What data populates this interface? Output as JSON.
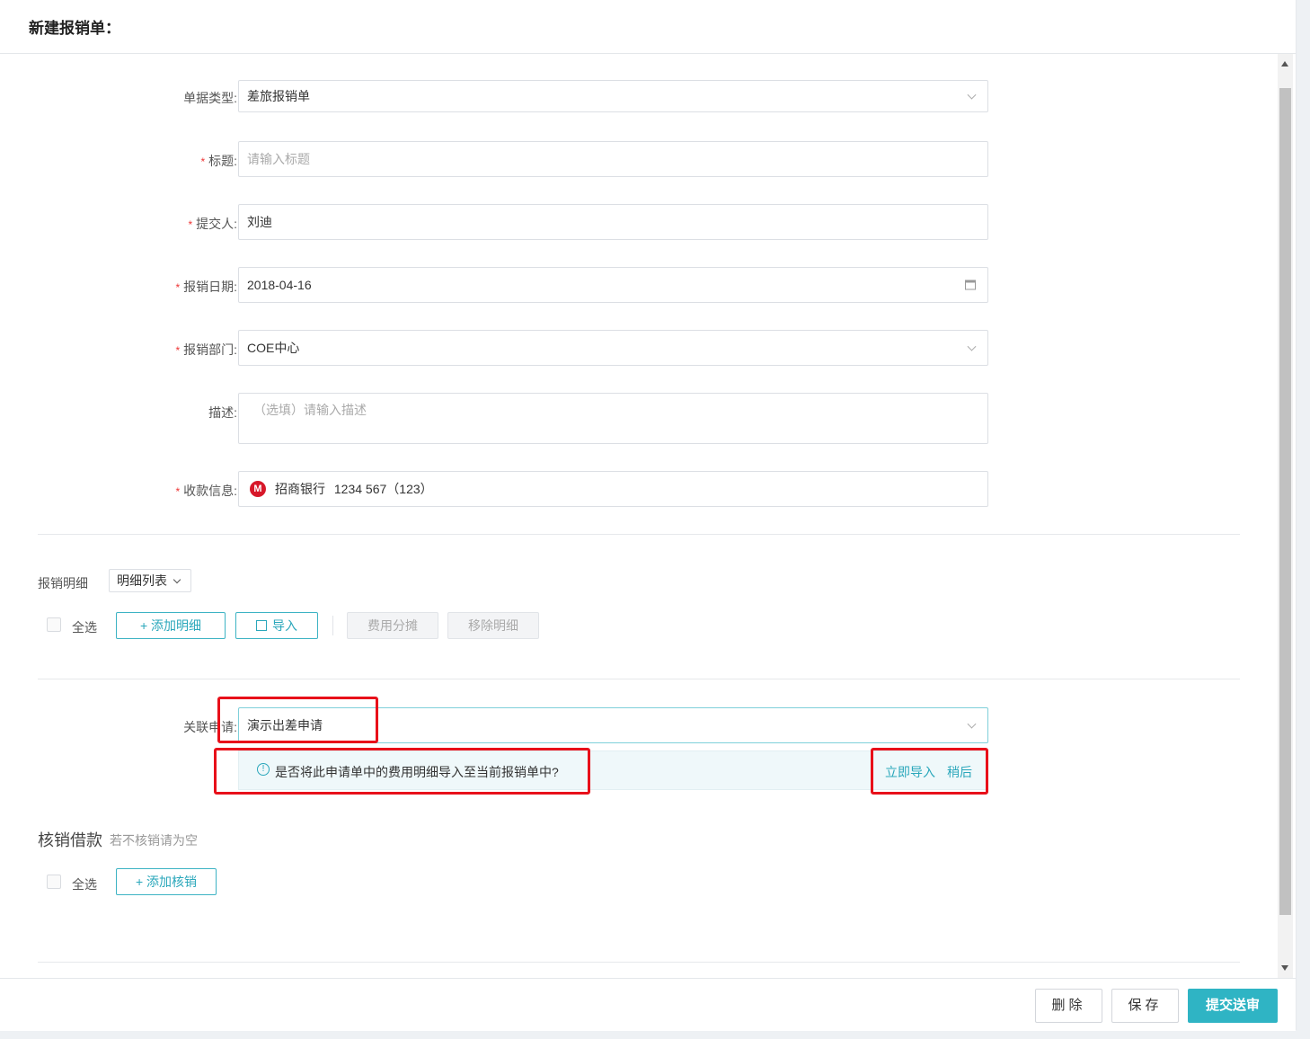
{
  "header": {
    "title": "新建报销单："
  },
  "form": {
    "doc_type": {
      "label": "单据类型:",
      "value": "差旅报销单"
    },
    "title": {
      "label": "标题:",
      "placeholder": "请输入标题"
    },
    "submitter": {
      "label": "提交人:",
      "value": "刘迪"
    },
    "date": {
      "label": "报销日期:",
      "value": "2018-04-16"
    },
    "department": {
      "label": "报销部门:",
      "value": "COE中心"
    },
    "description": {
      "label": "描述:",
      "placeholder": "（选填）请输入描述"
    },
    "payee": {
      "label": "收款信息:",
      "bank": "招商银行",
      "account": "1234 567（123）",
      "bank_icon": "bank-logo-icon"
    }
  },
  "details": {
    "label": "报销明细",
    "view_select": "明细列表",
    "select_all": "全选",
    "add_button": "+ 添加明细",
    "import_button": "导入",
    "split_button": "费用分摊",
    "remove_button": "移除明细"
  },
  "related": {
    "label": "关联申请:",
    "value": "演示出差申请",
    "alert_text": "是否将此申请单中的费用明细导入至当前报销单中?",
    "import_now": "立即导入",
    "later": "稍后"
  },
  "writeoff": {
    "title": "核销借款",
    "hint": "若不核销请为空",
    "select_all": "全选",
    "add_button": "+ 添加核销"
  },
  "footer": {
    "delete": "删除",
    "save": "保存",
    "submit": "提交送审"
  },
  "colors": {
    "accent": "#2fb4c4",
    "required": "#e33333",
    "highlight": "#e8101a"
  }
}
